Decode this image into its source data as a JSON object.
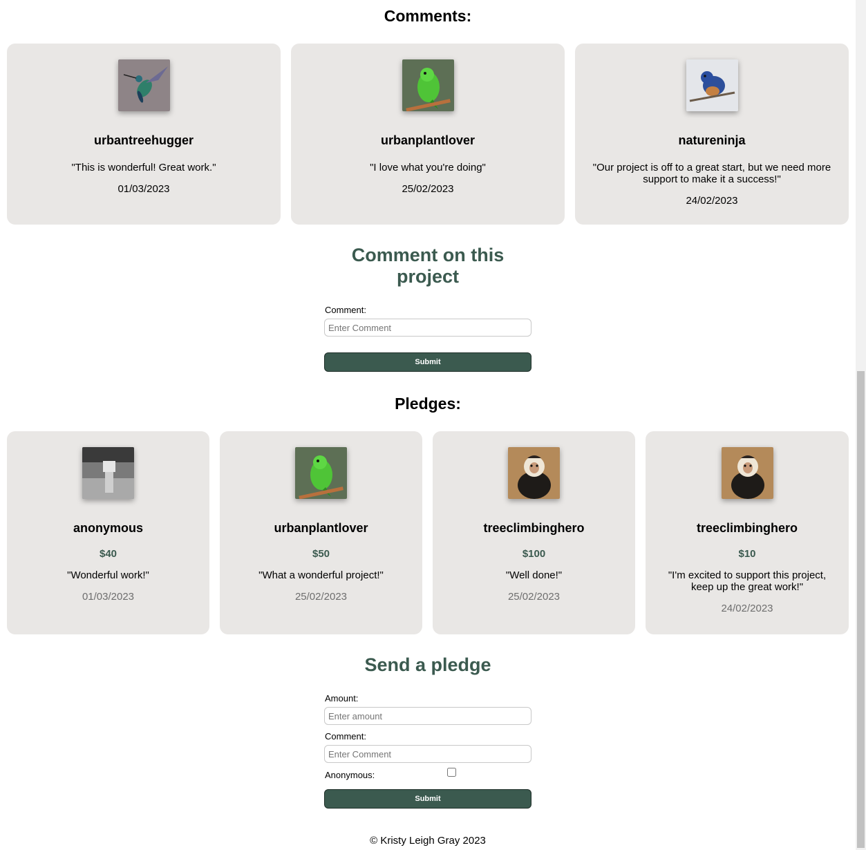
{
  "comments_section": {
    "heading": "Comments:",
    "items": [
      {
        "username": "urbantreehugger",
        "text": "\"This is wonderful! Great work.\"",
        "date": "01/03/2023",
        "avatar": "hummingbird-avatar"
      },
      {
        "username": "urbanplantlover",
        "text": "\"I love what you're doing\"",
        "date": "25/02/2023",
        "avatar": "green-parrot-avatar"
      },
      {
        "username": "natureninja",
        "text": "\"Our project is off to a great start, but we need more support to make it a success!\"",
        "date": "24/02/2023",
        "avatar": "bluebird-avatar"
      }
    ]
  },
  "comment_form": {
    "title": "Comment on this project",
    "comment_label": "Comment:",
    "comment_placeholder": "Enter Comment",
    "submit_label": "Submit"
  },
  "pledges_section": {
    "heading": "Pledges:",
    "items": [
      {
        "username": "anonymous",
        "amount": "$40",
        "text": "\"Wonderful work!\"",
        "date": "01/03/2023",
        "avatar": "box-head-person-avatar"
      },
      {
        "username": "urbanplantlover",
        "amount": "$50",
        "text": "\"What a wonderful project!\"",
        "date": "25/02/2023",
        "avatar": "green-parrot-avatar"
      },
      {
        "username": "treeclimbinghero",
        "amount": "$100",
        "text": "\"Well done!\"",
        "date": "25/02/2023",
        "avatar": "capuchin-monkey-avatar"
      },
      {
        "username": "treeclimbinghero",
        "amount": "$10",
        "text": "\"I'm excited to support this project, keep up the great work!\"",
        "date": "24/02/2023",
        "avatar": "capuchin-monkey-avatar"
      }
    ]
  },
  "pledge_form": {
    "title": "Send a pledge",
    "amount_label": "Amount:",
    "amount_placeholder": "Enter amount",
    "comment_label": "Comment:",
    "comment_placeholder": "Enter Comment",
    "anonymous_label": "Anonymous:",
    "anonymous_checked": false,
    "submit_label": "Submit"
  },
  "footer": {
    "text": "© Kristy Leigh Gray 2023"
  },
  "colors": {
    "accent": "#3b5a4f",
    "card_bg": "#e9e7e5"
  }
}
